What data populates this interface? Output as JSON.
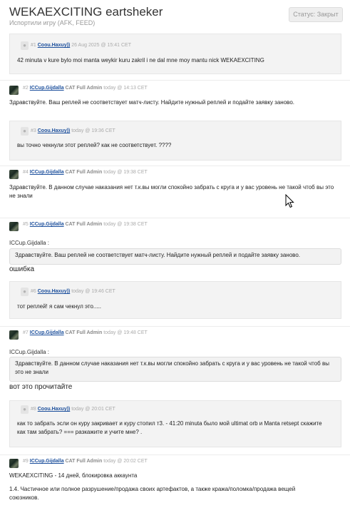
{
  "header": {
    "title": "WEKAEXCITING eartsheker",
    "subtitle": "Испортили игру (AFK, FEED)",
    "status": "Статус: Закрыт"
  },
  "posts": [
    {
      "num": "#1",
      "author": "Coou.Haxuy))",
      "role": "",
      "date": "26 Aug 2025 @ 15:41 CET",
      "text": "42 minuta v kure bylo moi manta weykir kuru zakril i ne dal mne moy mantu nick WEKAEXCITING"
    },
    {
      "num": "#2",
      "author": "ICCup.Gijdalla",
      "role": "CAT Full Admin",
      "date": "today @ 14:13 CET",
      "text": "Здравствуйте. Ваш реплей не соответствует матч-листу. Найдите нужный реплей и подайте заявку заново."
    },
    {
      "num": "#3",
      "author": "Coou.Haxuy))",
      "role": "",
      "date": "today @ 19:36 CET",
      "text": "вы точно чекнули этот реплей? как не соответствует. ????"
    },
    {
      "num": "#4",
      "author": "ICCup.Gijdalla",
      "role": "CAT Full Admin",
      "date": "today @ 19:38 CET",
      "text": "Здравствуйте. В данном случае наказания нет т.к.вы могли спокойно забрать с круга и у вас уровень не такой чтоб вы это не знали"
    },
    {
      "num": "#5",
      "author": "ICCup.Gijdalla",
      "role": "CAT Full Admin",
      "date": "today @ 19:38 CET",
      "quote_author": "ICCup.Gijdalla :",
      "quote": "Здравствуйте. Ваш реплей не соответствует матч-листу. Найдите нужный реплей и подайте заявку заново.",
      "text": "ошибка"
    },
    {
      "num": "#6",
      "author": "Coou.Haxuy))",
      "role": "",
      "date": "today @ 19:46 CET",
      "text": "тот реплей! я сам чекнул это....."
    },
    {
      "num": "#7",
      "author": "ICCup.Gijdalla",
      "role": "CAT Full Admin",
      "date": "today @ 19:48 CET",
      "quote_author": "ICCup.Gijdalla :",
      "quote": "Здравствуйте. В данном случае наказания нет т.к.вы могли спокойно забрать с круга и у вас уровень не такой чтоб вы это не знали",
      "text": "вот это прочитайте"
    },
    {
      "num": "#8",
      "author": "Coou.Haxuy))",
      "role": "",
      "date": "today @ 20:01 CET",
      "text": "как то забрать эсли он куру закривает и куру стопил т3. - 41:20 minuta было мой ultimat orb и Manta retsept скажите как там забрать? === разкажите и учите мне? ."
    },
    {
      "num": "#9",
      "author": "ICCup.Gijdalla",
      "role": "CAT Full Admin",
      "date": "today @ 20:02 CET",
      "text": "WEKAEXCITING - 14 дней, блокировка аккаунта",
      "text2": "1.4. Частичное или полное разрушение/продажа своих артефактов, а также кража/поломка/продажа вещей союзников."
    }
  ]
}
